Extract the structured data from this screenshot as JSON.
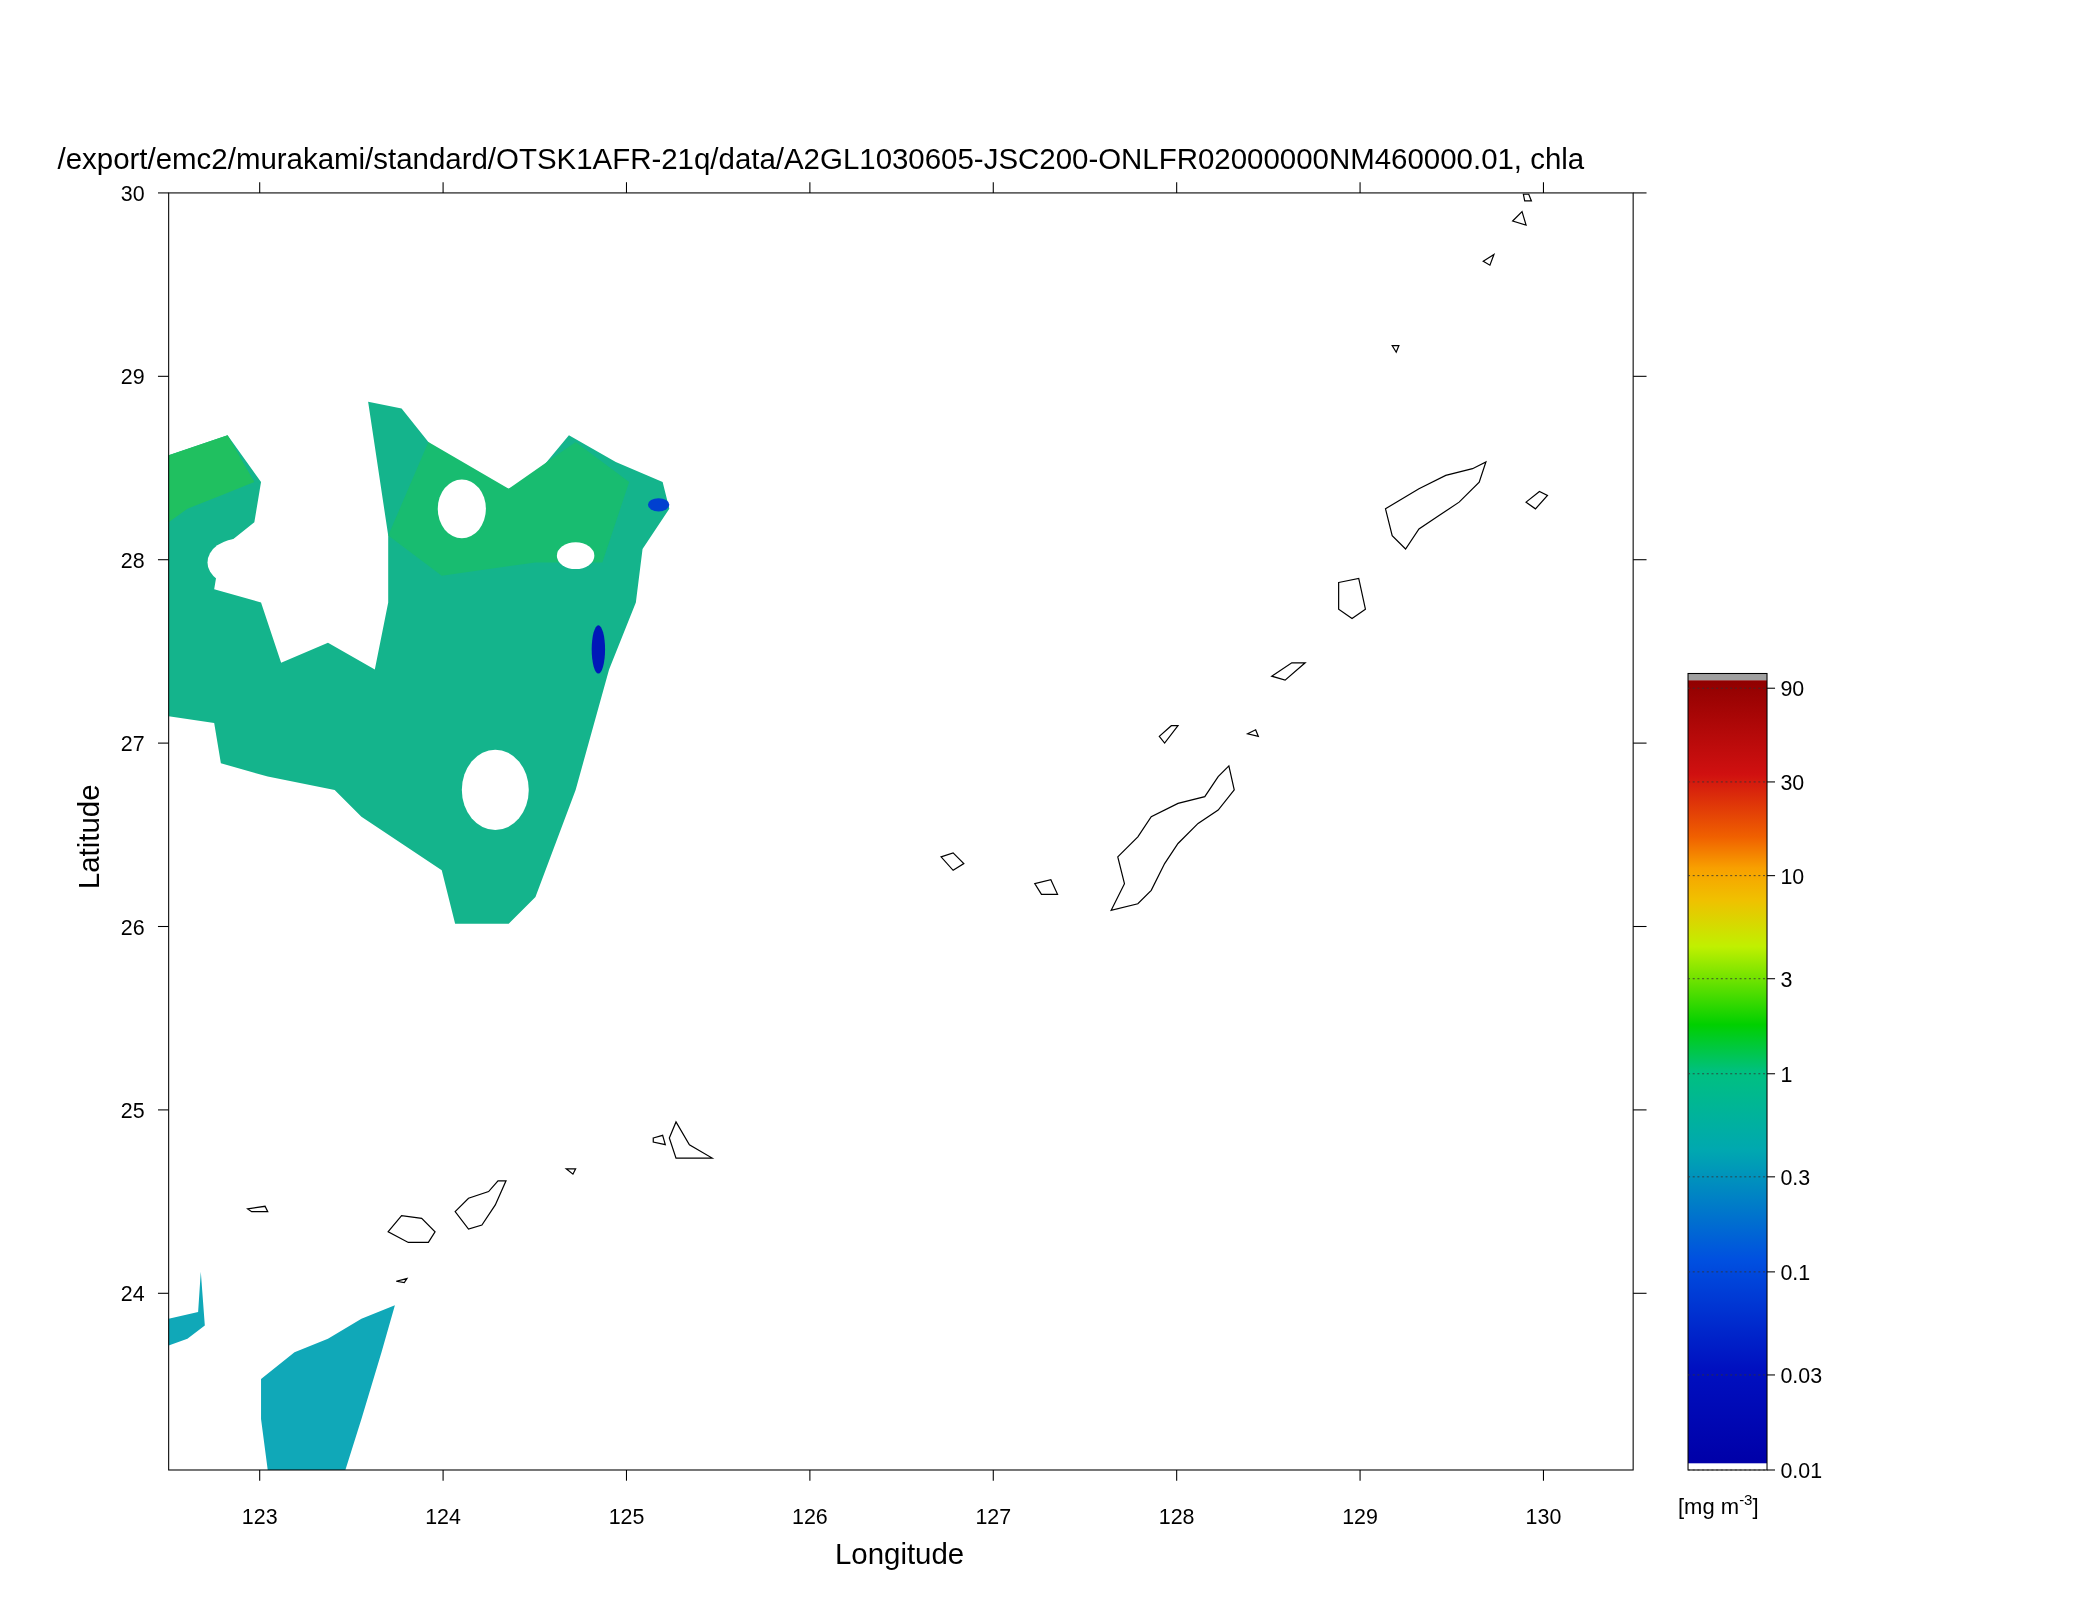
{
  "plot": {
    "title": "/export/emc2/murakami/standard/OTSK1AFR-21q/data/A2GL1030605-JSC200-ONLFR02000000NM460000.01, chla",
    "xlabel": "Longitude",
    "ylabel": "Latitude",
    "xticks": [
      "123",
      "124",
      "125",
      "126",
      "127",
      "128",
      "129",
      "130"
    ],
    "yticks": [
      "30",
      "29",
      "28",
      "27",
      "26",
      "25",
      "24"
    ]
  },
  "colorbar": {
    "ticks": [
      "90",
      "30",
      "10",
      "3",
      "1",
      "0.3",
      "0.1",
      "0.03",
      "0.01"
    ],
    "unit": "[mg m$^{-3}$]"
  }
}
